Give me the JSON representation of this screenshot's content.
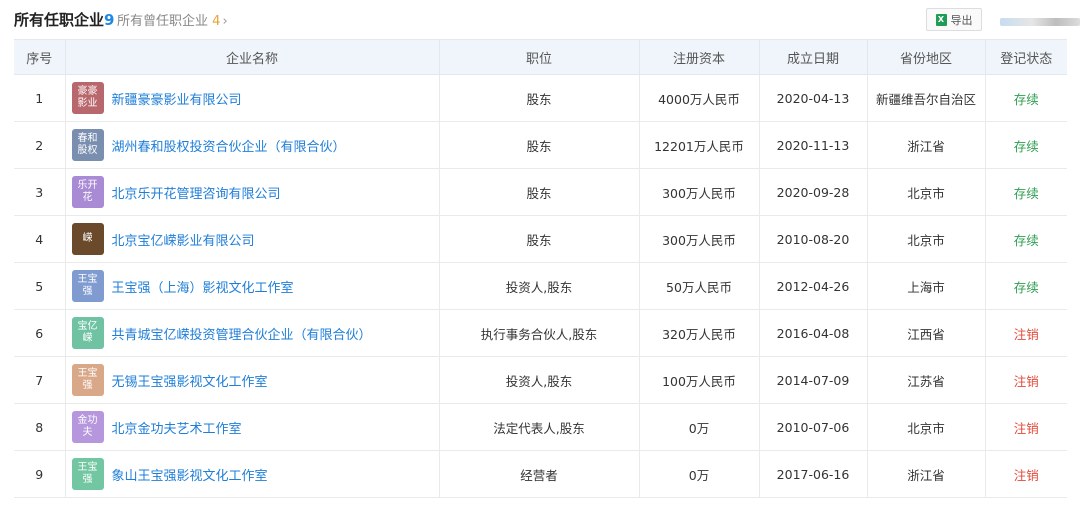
{
  "header": {
    "current_label": "所有任职企业",
    "current_count": "9",
    "former_label": "所有曾任职企业",
    "former_count": "4",
    "former_chevron": "›",
    "export_label": "导出",
    "export_icon_letter": "X"
  },
  "table": {
    "columns": [
      "序号",
      "企业名称",
      "职位",
      "注册资本",
      "成立日期",
      "省份地区",
      "登记状态"
    ],
    "rows": [
      {
        "seq": "1",
        "logo": "豪豪影业",
        "logo_color": "#b8676c",
        "name": "新疆豪豪影业有限公司",
        "position": "股东",
        "capital": "4000万人民币",
        "date": "2020-04-13",
        "province": "新疆维吾尔自治区",
        "status": "存续",
        "status_type": "active"
      },
      {
        "seq": "2",
        "logo": "春和股权",
        "logo_color": "#7a8fb0",
        "name": "湖州春和股权投资合伙企业（有限合伙）",
        "position": "股东",
        "capital": "12201万人民币",
        "date": "2020-11-13",
        "province": "浙江省",
        "status": "存续",
        "status_type": "active"
      },
      {
        "seq": "3",
        "logo": "乐开花",
        "logo_color": "#a98ad4",
        "name": "北京乐开花管理咨询有限公司",
        "position": "股东",
        "capital": "300万人民币",
        "date": "2020-09-28",
        "province": "北京市",
        "status": "存续",
        "status_type": "active"
      },
      {
        "seq": "4",
        "logo": "嵘",
        "logo_color": "#6b4a2b",
        "name": "北京宝亿嵘影业有限公司",
        "position": "股东",
        "capital": "300万人民币",
        "date": "2010-08-20",
        "province": "北京市",
        "status": "存续",
        "status_type": "active"
      },
      {
        "seq": "5",
        "logo": "王宝强",
        "logo_color": "#7f9bd0",
        "name": "王宝强（上海）影视文化工作室",
        "position": "投资人,股东",
        "capital": "50万人民币",
        "date": "2012-04-26",
        "province": "上海市",
        "status": "存续",
        "status_type": "active"
      },
      {
        "seq": "6",
        "logo": "宝亿嵘",
        "logo_color": "#6fc3a3",
        "name": "共青城宝亿嵘投资管理合伙企业（有限合伙）",
        "position": "执行事务合伙人,股东",
        "capital": "320万人民币",
        "date": "2016-04-08",
        "province": "江西省",
        "status": "注销",
        "status_type": "cancel"
      },
      {
        "seq": "7",
        "logo": "王宝强",
        "logo_color": "#d9a889",
        "name": "无锡王宝强影视文化工作室",
        "position": "投资人,股东",
        "capital": "100万人民币",
        "date": "2014-07-09",
        "province": "江苏省",
        "status": "注销",
        "status_type": "cancel"
      },
      {
        "seq": "8",
        "logo": "金功夫",
        "logo_color": "#b696dc",
        "name": "北京金功夫艺术工作室",
        "position": "法定代表人,股东",
        "capital": "0万",
        "date": "2010-07-06",
        "province": "北京市",
        "status": "注销",
        "status_type": "cancel"
      },
      {
        "seq": "9",
        "logo": "王宝强",
        "logo_color": "#72c7a2",
        "name": "象山王宝强影视文化工作室",
        "position": "经营者",
        "capital": "0万",
        "date": "2017-06-16",
        "province": "浙江省",
        "status": "注销",
        "status_type": "cancel"
      }
    ]
  }
}
